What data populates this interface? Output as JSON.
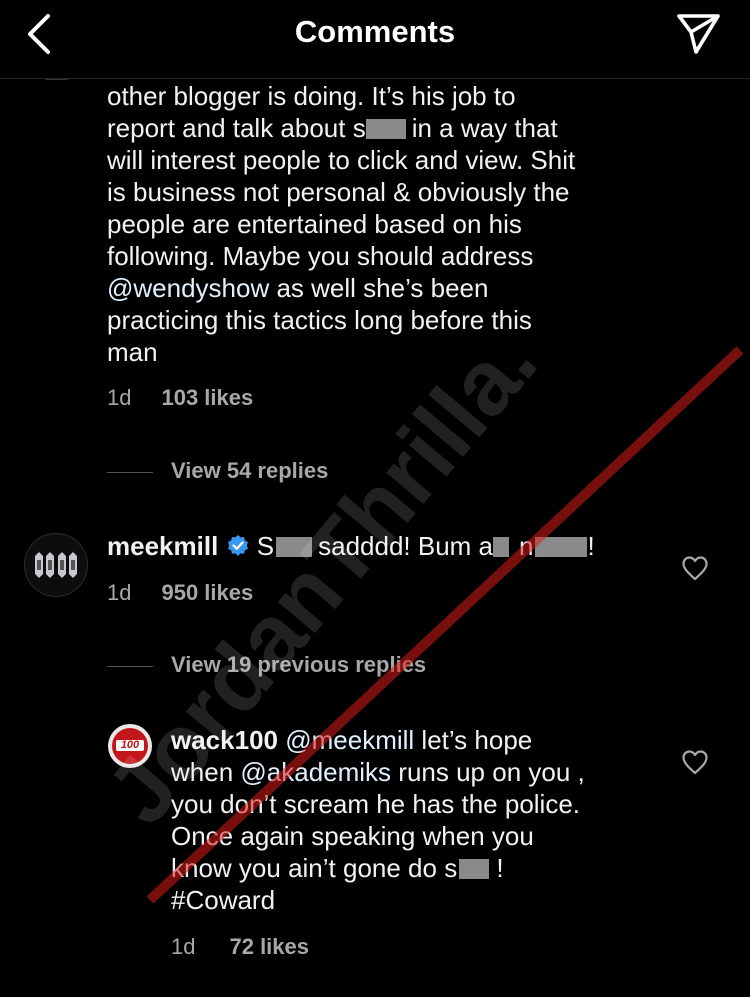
{
  "header": {
    "title": "Comments"
  },
  "comment1": {
    "line1": "other blogger is doing. It’s his job to",
    "line2_a": "report and talk about s",
    "line2_b": "in a way that",
    "line3": "will interest people to click and view. Shit",
    "line4": "is business not personal & obviously the",
    "line5": "people are entertained based on his",
    "line6": "following. Maybe you should address",
    "line7_mention": "@wendyshow",
    "line7_rest": " as well she’s been",
    "line8": "practicing this tactics long before this",
    "line9": "man",
    "time": "1d",
    "likes": "103 likes",
    "view_replies": "View 54 replies"
  },
  "comment2": {
    "username": "meekmill",
    "text_a": "S",
    "text_b": "sadddd! Bum a",
    "text_c": "n",
    "text_d": "!",
    "time": "1d",
    "likes": "950 likes",
    "view_replies": "View 19 previous replies"
  },
  "comment3": {
    "username": "wack100",
    "avatar_text": "100",
    "mention1": "@meekmill",
    "line1_rest": " let’s hope",
    "line2_a": "when ",
    "mention2": "@akademiks",
    "line2_b": " runs up on you ,",
    "line3": "you don’t scream he has the police.",
    "line4": "Once again speaking when you",
    "line5_a": "know you ain’t gone do s",
    "line5_b": " !",
    "line6": "#Coward",
    "time": "1d",
    "likes": "72 likes"
  },
  "watermark": "JordanThrilla.",
  "colors": {
    "background": "#000000",
    "text": "#f2f2f2",
    "secondary": "#a8a8a8",
    "verified": "#3897f0",
    "watermark_red": "#d81c1c"
  },
  "icons": {
    "back": "chevron-left-icon",
    "send": "paper-plane-icon",
    "heart": "heart-outline-icon",
    "verified": "verified-badge-icon"
  }
}
